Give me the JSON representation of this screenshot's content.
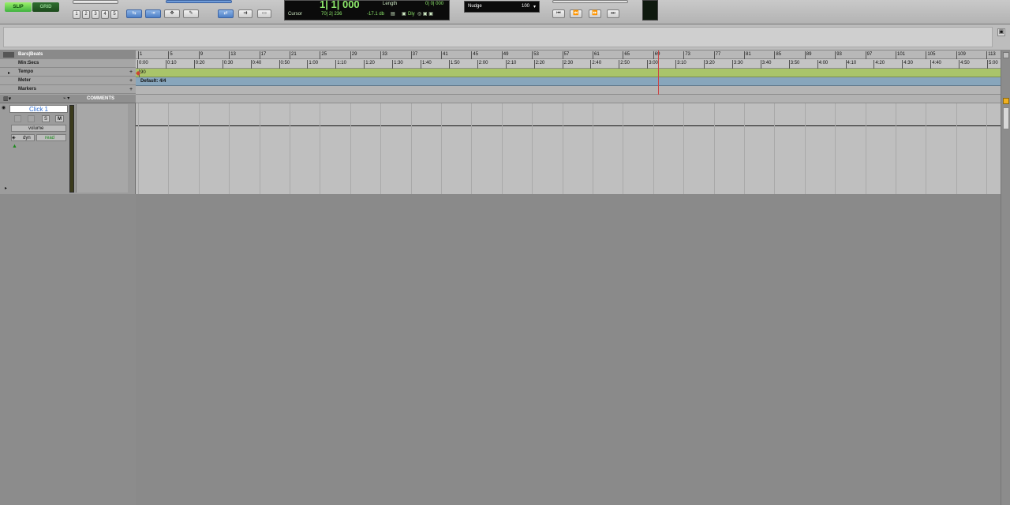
{
  "toolbar": {
    "mode_slip": "SLIP",
    "mode_grid": "GRID",
    "zoom_presets": [
      "1",
      "2",
      "3",
      "4",
      "5"
    ],
    "counter": {
      "main": "1| 1| 000",
      "length_label": "Length",
      "length_value": "0| 0| 000",
      "cursor_label": "Cursor",
      "cursor_value": "70| 2| 236",
      "level": "-17.1 db",
      "dly": "Dly"
    },
    "nudge_label": "Nudge",
    "nudge_value": "100"
  },
  "rulers": {
    "labels": [
      "Bars|Beats",
      "Min:Secs",
      "Tempo",
      "Meter",
      "Markers"
    ],
    "bars": [
      "1",
      "5",
      "9",
      "13",
      "17",
      "21",
      "25",
      "29",
      "33",
      "37",
      "41",
      "45",
      "49",
      "53",
      "57",
      "61",
      "65",
      "69",
      "73",
      "77",
      "81",
      "85",
      "89",
      "93",
      "97",
      "101",
      "105",
      "109",
      "113"
    ],
    "minsecs": [
      "0:00",
      "0:10",
      "0:20",
      "0:30",
      "0:40",
      "0:50",
      "1:00",
      "1:10",
      "1:20",
      "1:30",
      "1:40",
      "1:50",
      "2:00",
      "2:10",
      "2:20",
      "2:30",
      "2:40",
      "2:50",
      "3:00",
      "3:10",
      "3:20",
      "3:30",
      "3:40",
      "3:50",
      "4:00",
      "4:10",
      "4:20",
      "4:30",
      "4:40",
      "4:50",
      "5:00"
    ],
    "tempo_value": "90",
    "meter_value": "Default: 4/4"
  },
  "track": {
    "name": "Click 1",
    "comments_header": "COMMENTS",
    "view": "volume",
    "automation_mode": "read",
    "dyn": "dyn",
    "mute": "M",
    "solo": "S"
  },
  "colors": {
    "tempo_ruler": "#a9c46a",
    "meter_ruler": "#88a6bc",
    "counter_bg": "#0b0b0b",
    "counter_text": "#8de86b",
    "mode_slip": "#2f9a2f"
  }
}
